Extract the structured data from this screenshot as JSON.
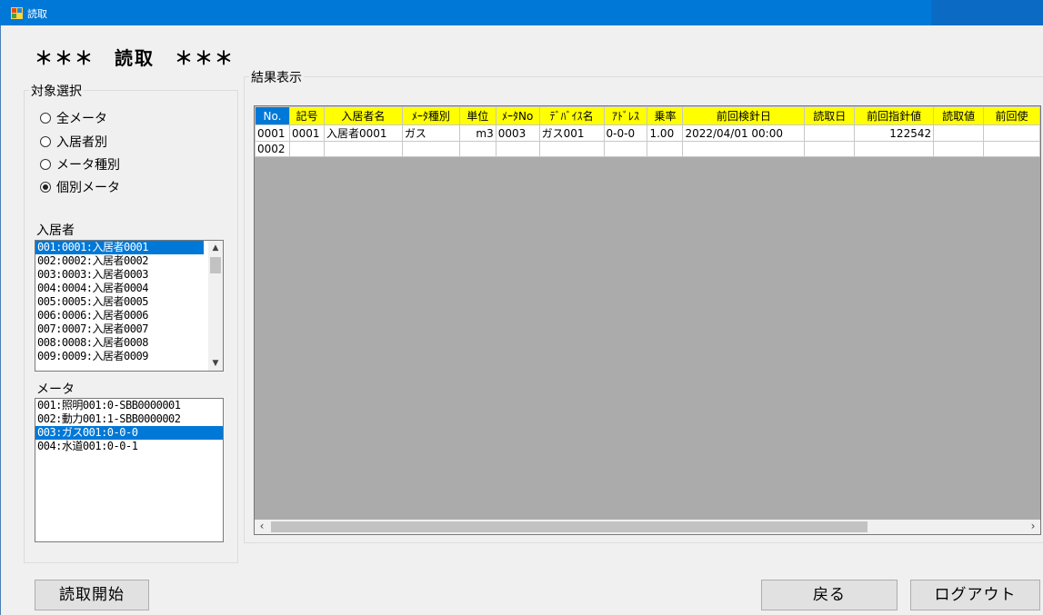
{
  "window": {
    "title": "読取"
  },
  "heading": "＊＊＊　読取　＊＊＊",
  "target_group": {
    "title": "対象選択",
    "options": [
      {
        "label": "全メータ",
        "checked": false
      },
      {
        "label": "入居者別",
        "checked": false
      },
      {
        "label": "メータ種別",
        "checked": false
      },
      {
        "label": "個別メータ",
        "checked": true
      }
    ],
    "residents_label": "入居者",
    "residents": [
      "001:0001:入居者0001",
      "002:0002:入居者0002",
      "003:0003:入居者0003",
      "004:0004:入居者0004",
      "005:0005:入居者0005",
      "006:0006:入居者0006",
      "007:0007:入居者0007",
      "008:0008:入居者0008",
      "009:0009:入居者0009"
    ],
    "residents_selected": 0,
    "meters_label": "メータ",
    "meters": [
      "001:照明001:0-SBB0000001",
      "002:動力001:1-SBB0000002",
      "003:ガス001:0-0-0",
      "004:水道001:0-0-1"
    ],
    "meters_selected": 2
  },
  "result_group": {
    "title": "結果表示",
    "columns": [
      "No.",
      "記号",
      "入居者名",
      "ﾒｰﾀ種別",
      "単位",
      "ﾒｰﾀNo",
      "ﾃﾞﾊﾞｲｽ名",
      "ｱﾄﾞﾚｽ",
      "乗率",
      "前回検針日",
      "読取日",
      "前回指針値",
      "読取値",
      "前回使"
    ],
    "rows": [
      [
        "0001",
        "0001",
        "入居者0001",
        "ガス",
        "m3",
        "0003",
        "ガス001",
        "0-0-0",
        "1.00",
        "2022/04/01 00:00",
        "",
        "122542",
        "",
        ""
      ],
      [
        "0002",
        "",
        "",
        "",
        "",
        "",
        "",
        "",
        "",
        "",
        "",
        "",
        "",
        ""
      ]
    ]
  },
  "buttons": {
    "start": "読取開始",
    "back": "戻る",
    "logout": "ログアウト"
  }
}
